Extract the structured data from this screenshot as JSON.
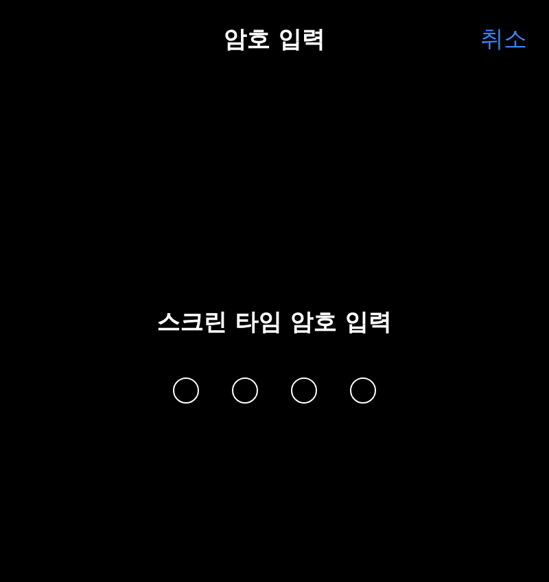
{
  "nav_bar": {
    "title": "암호 입력",
    "cancel": "취소"
  },
  "prompt": "스크린 타임 암호 입력",
  "passcode": {
    "digits": [
      {
        "filled": false
      },
      {
        "filled": false
      },
      {
        "filled": false
      },
      {
        "filled": false
      }
    ]
  }
}
